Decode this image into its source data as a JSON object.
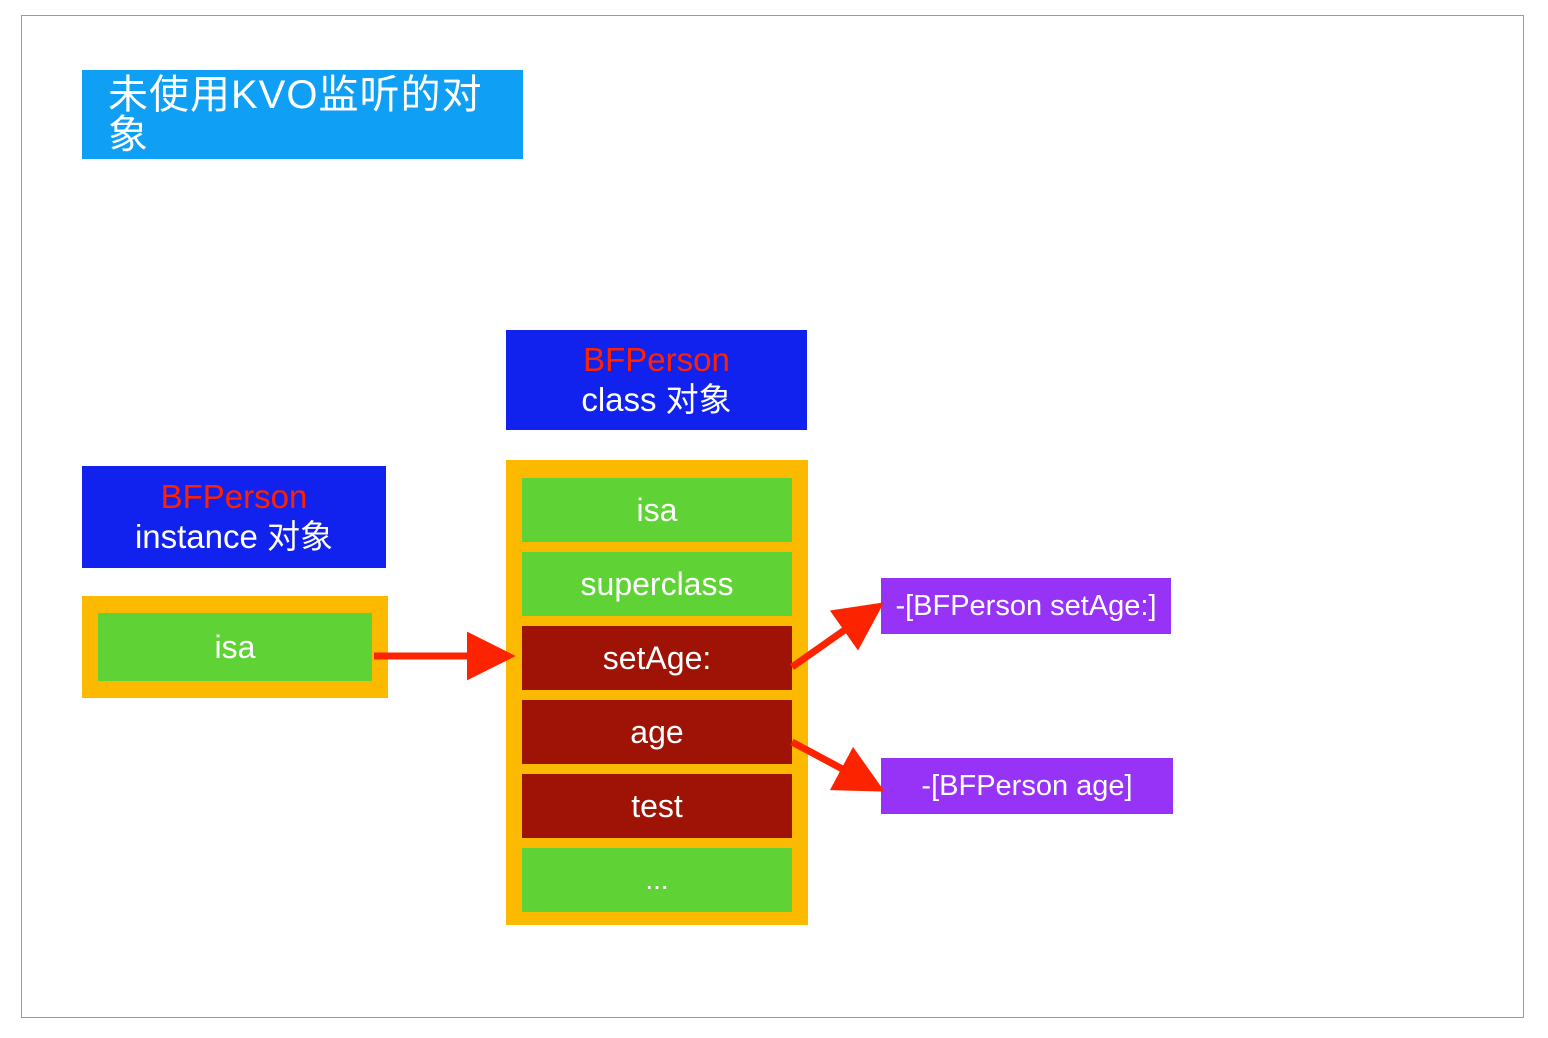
{
  "page": {
    "title_banner": {
      "text": "未使用KVO监听的对象",
      "background": "#0fa0f5",
      "text_color": "#ffffff"
    },
    "border_color": "#9a9a9a",
    "background": "#ffffff"
  },
  "instance_object": {
    "label_line1": "BFPerson",
    "label_line2": "instance 对象",
    "label_bg": "#1122ee",
    "label_line1_color": "#ff2200",
    "label_line2_color": "#ffffff",
    "container_bg": "#fbb900",
    "slots": [
      {
        "text": "isa",
        "color": "#5fd336",
        "kind": "pointer"
      }
    ]
  },
  "class_object": {
    "label_line1": "BFPerson",
    "label_line2": "class 对象",
    "label_bg": "#1122ee",
    "label_line1_color": "#ff2200",
    "label_line2_color": "#ffffff",
    "container_bg": "#fbb900",
    "slots": [
      {
        "text": "isa",
        "color": "#5fd336",
        "kind": "pointer"
      },
      {
        "text": "superclass",
        "color": "#5fd336",
        "kind": "pointer"
      },
      {
        "text": "setAge:",
        "color": "#9e1306",
        "kind": "method"
      },
      {
        "text": "age",
        "color": "#9e1306",
        "kind": "method"
      },
      {
        "text": "test",
        "color": "#9e1306",
        "kind": "method"
      },
      {
        "text": "...",
        "color": "#5fd336",
        "kind": "more"
      }
    ]
  },
  "methods": [
    {
      "text": "-[BFPerson setAge:]",
      "bg": "#9633f7",
      "text_color": "#ffffff"
    },
    {
      "text": "-[BFPerson age]",
      "bg": "#9633f7",
      "text_color": "#ffffff"
    }
  ],
  "arrows": {
    "color": "#fc2400",
    "items": [
      {
        "name": "instance-isa-to-class",
        "from": "instance isa slot",
        "to": "BFPerson class 对象"
      },
      {
        "name": "setage-to-imp",
        "from": "setAge: slot",
        "to": "-[BFPerson setAge:]"
      },
      {
        "name": "age-to-imp",
        "from": "age slot",
        "to": "-[BFPerson age]"
      }
    ]
  }
}
